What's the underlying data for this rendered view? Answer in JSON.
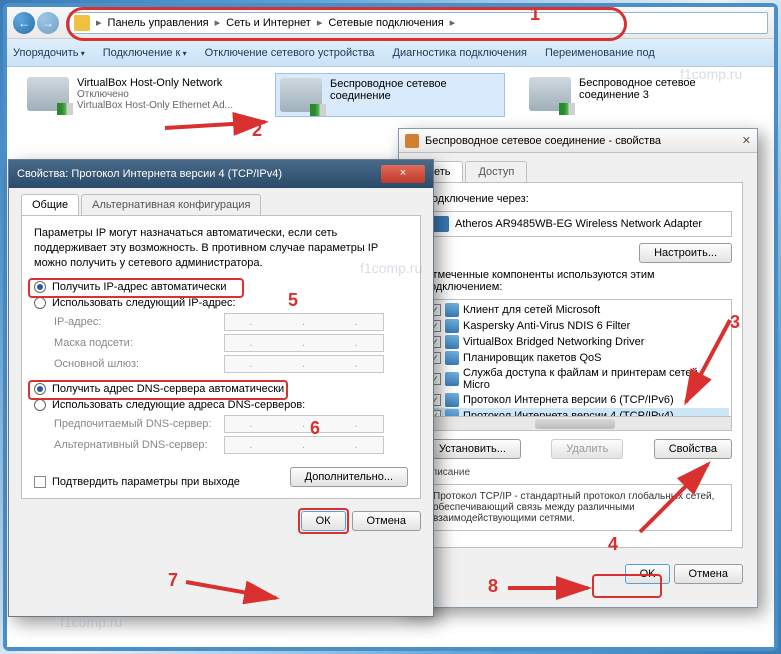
{
  "breadcrumb": {
    "a": "Панель управления",
    "b": "Сеть и Интернет",
    "c": "Сетевые подключения"
  },
  "toolbar": {
    "org": "Упорядочить",
    "conn": "Подключение к",
    "disable": "Отключение сетевого устройства",
    "diag": "Диагностика подключения",
    "rename": "Переименование под"
  },
  "net1": {
    "title": "VirtualBox Host-Only Network",
    "state": "Отключено",
    "adapter": "VirtualBox Host-Only Ethernet Ad..."
  },
  "net2": {
    "title": "Беспроводное сетевое",
    "sub": "соединение"
  },
  "net3": {
    "title": "Беспроводное сетевое",
    "sub": "соединение 3"
  },
  "dlg2": {
    "title": "Беспроводное сетевое соединение - свойства",
    "tab_net": "Сеть",
    "tab_access": "Доступ",
    "conn_via": "Подключение через:",
    "adapter": "Atheros AR9485WB-EG Wireless Network Adapter",
    "configure": "Настроить...",
    "comp_label": "Отмеченные компоненты используются этим подключением:",
    "c1": "Клиент для сетей Microsoft",
    "c2": "Kaspersky Anti-Virus NDIS 6 Filter",
    "c3": "VirtualBox Bridged Networking Driver",
    "c4": "Планировщик пакетов QoS",
    "c5": "Служба доступа к файлам и принтерам сетей Micro",
    "c6": "Протокол Интернета версии 6 (TCP/IPv6)",
    "c7": "Протокол Интернета версии 4 (TCP/IPv4)",
    "install": "Установить...",
    "remove": "Удалить",
    "props": "Свойства",
    "desc_h": "Описание",
    "desc": "Протокол TCP/IP - стандартный протокол глобальных сетей, обеспечивающий связь между различными взаимодействующими сетями.",
    "ok": "OK",
    "cancel": "Отмена"
  },
  "dlg1": {
    "title": "Свойства: Протокол Интернета версии 4 (TCP/IPv4)",
    "tab_gen": "Общие",
    "tab_alt": "Альтернативная конфигурация",
    "para": "Параметры IP могут назначаться автоматически, если сеть поддерживает эту возможность. В противном случае параметры IP можно получить у сетевого администратора.",
    "r1": "Получить IP-адрес автоматически",
    "r2": "Использовать следующий IP-адрес:",
    "ip": "IP-адрес:",
    "mask": "Маска подсети:",
    "gw": "Основной шлюз:",
    "r3": "Получить адрес DNS-сервера автоматически",
    "r4": "Использовать следующие адреса DNS-серверов:",
    "dns1": "Предпочитаемый DNS-сервер:",
    "dns2": "Альтернативный DNS-сервер:",
    "confirm": "Подтвердить параметры при выходе",
    "adv": "Дополнительно...",
    "ok": "ОК",
    "cancel": "Отмена"
  },
  "markers": {
    "m1": "1",
    "m2": "2",
    "m3": "3",
    "m4": "4",
    "m5": "5",
    "m6": "6",
    "m7": "7",
    "m8": "8"
  },
  "wm": "f1comp.ru"
}
